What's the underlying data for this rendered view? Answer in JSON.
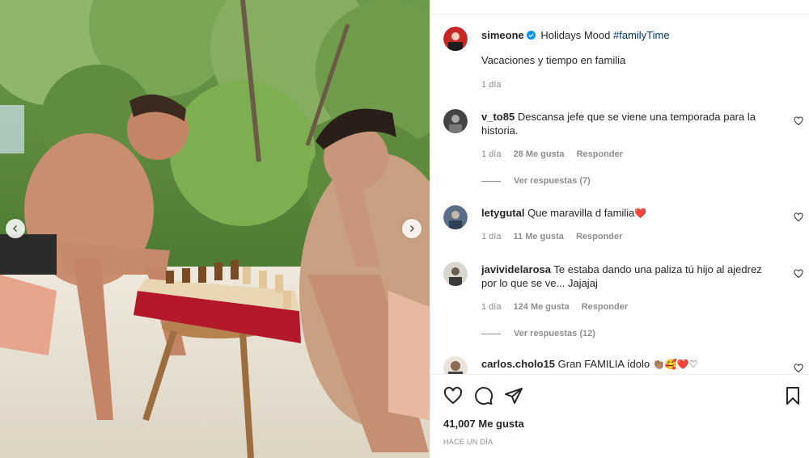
{
  "post": {
    "author": "simeone",
    "caption_title": "Holidays Mood",
    "caption_hashtag": "#familyTime",
    "caption_body": "Vacaciones y tiempo en familia",
    "caption_time": "1 día",
    "likes": "41,007 Me gusta",
    "posted": "HACE UN DÍA"
  },
  "comments": [
    {
      "user": "v_to85",
      "text": "Descansa jefe que se viene una temporada para la historia.",
      "time": "1 día",
      "likes": "28 Me gusta",
      "reply": "Responder",
      "view_replies": "Ver respuestas (7)"
    },
    {
      "user": "letygutal",
      "text": "Que maravilla d familia",
      "emoji": "❤️",
      "time": "1 día",
      "likes": "11 Me gusta",
      "reply": "Responder"
    },
    {
      "user": "javividelarosa",
      "text": "Te estaba dando una paliza tú hijo al ajedrez por lo que se ve... Jajajaj",
      "time": "1 día",
      "likes": "124 Me gusta",
      "reply": "Responder",
      "view_replies": "Ver respuestas (12)"
    },
    {
      "user": "carlos.cholo15",
      "text": "Gran FAMILIA ídolo",
      "emoji": "👏🏽🥰❤️♡"
    }
  ],
  "icons": {
    "like": "heart-icon",
    "comment": "comment-icon",
    "share": "share-icon",
    "save": "bookmark-icon",
    "prev": "chevron-left-icon",
    "next": "chevron-right-icon"
  },
  "colors": {
    "hashtag": "#00376b",
    "verified": "#0095f6",
    "heart_red": "#ed4956",
    "muted": "#8e8e8e"
  }
}
